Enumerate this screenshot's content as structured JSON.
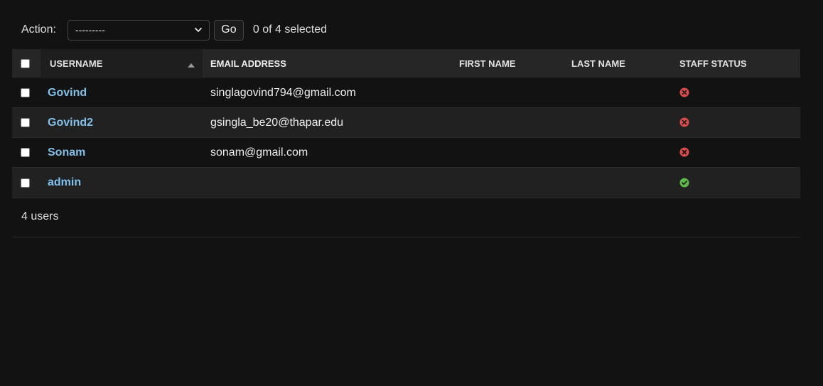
{
  "actions": {
    "label": "Action:",
    "select_value": "---------",
    "go_label": "Go",
    "selection_counter": "0 of 4 selected"
  },
  "table": {
    "headers": {
      "username": "USERNAME",
      "email": "EMAIL ADDRESS",
      "first_name": "FIRST NAME",
      "last_name": "LAST NAME",
      "staff_status": "STAFF STATUS"
    },
    "rows": [
      {
        "username": "Govind",
        "email": "singlagovind794@gmail.com",
        "first_name": "",
        "last_name": "",
        "staff": false,
        "staff_icon": "x-circle-icon"
      },
      {
        "username": "Govind2",
        "email": "gsingla_be20@thapar.edu",
        "first_name": "",
        "last_name": "",
        "staff": false,
        "staff_icon": "x-circle-icon"
      },
      {
        "username": "Sonam",
        "email": "sonam@gmail.com",
        "first_name": "",
        "last_name": "",
        "staff": false,
        "staff_icon": "x-circle-icon"
      },
      {
        "username": "admin",
        "email": "",
        "first_name": "",
        "last_name": "",
        "staff": true,
        "staff_icon": "check-circle-icon"
      }
    ]
  },
  "footer": {
    "count": "4 users"
  },
  "colors": {
    "background": "#121212",
    "link": "#81c1e9",
    "status_false": "#dc4b4b",
    "status_true": "#5fb84a"
  }
}
